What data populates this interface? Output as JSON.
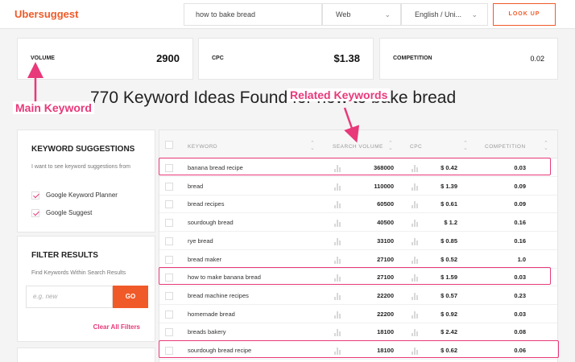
{
  "header": {
    "logo": "Ubersuggest",
    "search_value": "how to bake bread",
    "platform_select": "Web",
    "language_select": "English / Uni...",
    "lookup_label": "LOOK UP"
  },
  "metrics": {
    "volume_label": "VOLUME",
    "volume_value": "2900",
    "cpc_label": "CPC",
    "cpc_value": "$1.38",
    "competition_label": "COMPETITION",
    "competition_value": "0.02"
  },
  "ideas_title": "770 Keyword Ideas Found for how to bake bread",
  "annotations": {
    "main_keyword": "Main Keyword",
    "related_keywords": "Related Keywords",
    "color": "#e8397a"
  },
  "suggestions": {
    "title": "KEYWORD SUGGESTIONS",
    "description": "I want to see keyword suggestions from",
    "options": [
      "Google Keyword Planner",
      "Google Suggest"
    ]
  },
  "filter": {
    "title": "FILTER RESULTS",
    "description": "Find Keywords Within Search Results",
    "placeholder": "e.g. new",
    "go_label": "GO",
    "clear_label": "Clear All Filters"
  },
  "table": {
    "columns": [
      "KEYWORD",
      "SEARCH VOLUME",
      "CPC",
      "COMPETITION"
    ],
    "rows": [
      {
        "keyword": "banana bread recipe",
        "volume": "368000",
        "cpc": "$ 0.42",
        "competition": "0.03",
        "highlight": true
      },
      {
        "keyword": "bread",
        "volume": "110000",
        "cpc": "$ 1.39",
        "competition": "0.09",
        "highlight": false
      },
      {
        "keyword": "bread recipes",
        "volume": "60500",
        "cpc": "$ 0.61",
        "competition": "0.09",
        "highlight": false
      },
      {
        "keyword": "sourdough bread",
        "volume": "40500",
        "cpc": "$ 1.2",
        "competition": "0.16",
        "highlight": false
      },
      {
        "keyword": "rye bread",
        "volume": "33100",
        "cpc": "$ 0.85",
        "competition": "0.16",
        "highlight": false
      },
      {
        "keyword": "bread maker",
        "volume": "27100",
        "cpc": "$ 0.52",
        "competition": "1.0",
        "highlight": false
      },
      {
        "keyword": "how to make banana bread",
        "volume": "27100",
        "cpc": "$ 1.59",
        "competition": "0.03",
        "highlight": true
      },
      {
        "keyword": "bread machine recipes",
        "volume": "22200",
        "cpc": "$ 0.57",
        "competition": "0.23",
        "highlight": false
      },
      {
        "keyword": "homemade bread",
        "volume": "22200",
        "cpc": "$ 0.92",
        "competition": "0.03",
        "highlight": false
      },
      {
        "keyword": "breads bakery",
        "volume": "18100",
        "cpc": "$ 2.42",
        "competition": "0.08",
        "highlight": false
      },
      {
        "keyword": "sourdough bread recipe",
        "volume": "18100",
        "cpc": "$ 0.62",
        "competition": "0.06",
        "highlight": true
      }
    ]
  },
  "colors": {
    "brand": "#f05a28",
    "highlight": "#e8397a"
  }
}
